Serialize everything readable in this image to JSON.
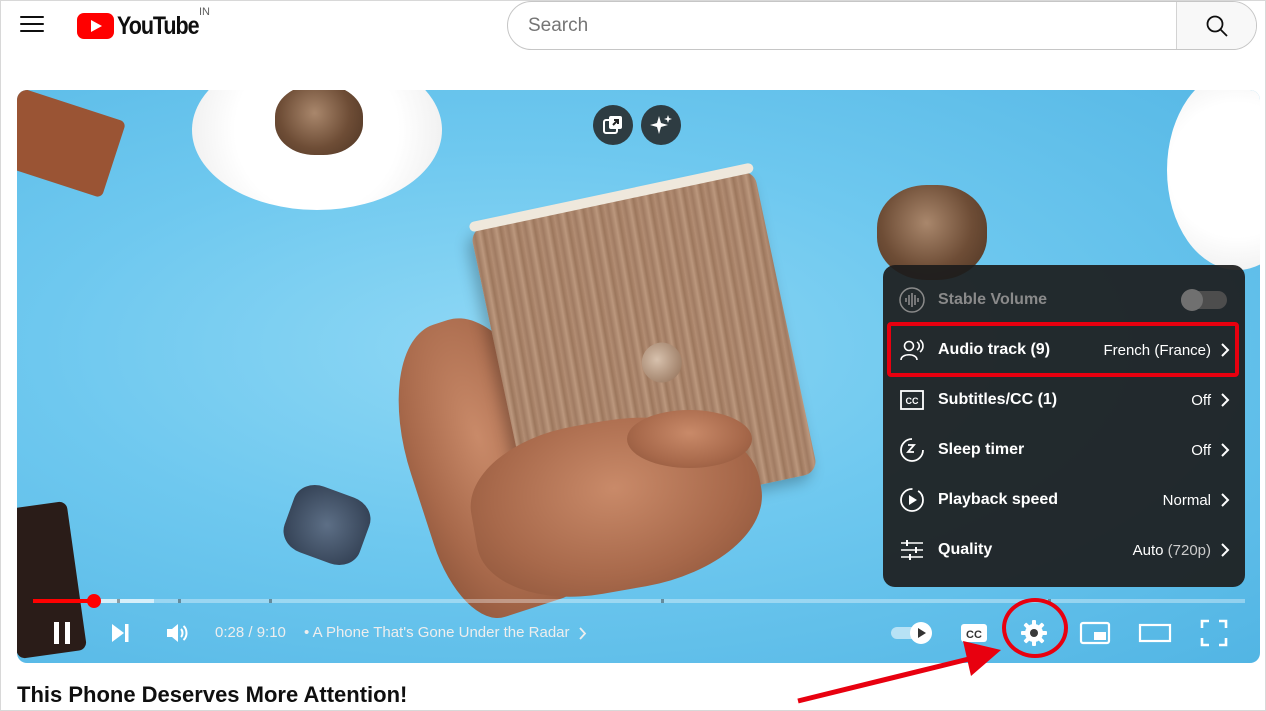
{
  "header": {
    "logo_text": "YouTube",
    "country_code": "IN",
    "search_placeholder": "Search",
    "search_value": ""
  },
  "player": {
    "current_time": "0:28",
    "duration": "9:10",
    "time_display": "0:28 / 9:10",
    "chapter_title": "A Phone That's Gone Under the Radar",
    "progress_fraction": 0.05,
    "buffered_fraction": 0.1,
    "accent_color": "#ff0000"
  },
  "settings_menu": {
    "items": [
      {
        "label": "Stable Volume",
        "value": "",
        "icon": "stable-volume-icon",
        "toggle": false
      },
      {
        "label": "Audio track (9)",
        "value": "French (France)",
        "icon": "audio-track-icon"
      },
      {
        "label": "Subtitles/CC (1)",
        "value": "Off",
        "icon": "subtitles-icon"
      },
      {
        "label": "Sleep timer",
        "value": "Off",
        "icon": "sleep-timer-icon"
      },
      {
        "label": "Playback speed",
        "value": "Normal",
        "icon": "playback-speed-icon"
      },
      {
        "label": "Quality",
        "value": "Auto",
        "value_suffix": "(720p)",
        "icon": "quality-icon"
      }
    ],
    "highlighted_item": "Audio track (9)",
    "annotation_color": "#e8000f"
  },
  "video": {
    "title": "This Phone Deserves More Attention!"
  }
}
